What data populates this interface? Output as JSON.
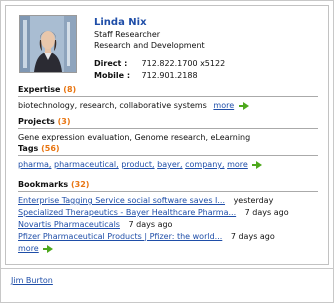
{
  "person": {
    "name": "Linda Nix",
    "title": "Staff Researcher",
    "department": "Research and Development",
    "direct_label": "Direct :",
    "direct": "712.822.1700 x5122",
    "mobile_label": "Mobile :",
    "mobile": "712.901.2188"
  },
  "expertise": {
    "label": "Expertise",
    "count": "(8)",
    "text": "biotechnology,  research,  collaborative systems",
    "more": "more"
  },
  "projects": {
    "label": "Projects",
    "count": "(3)",
    "text": "Gene expression evaluation,  Genome research,  eLearning"
  },
  "tags": {
    "label": "Tags",
    "count": "(56)",
    "items": [
      "pharma,",
      "pharmaceutical,",
      "product,",
      "bayer,",
      "company,"
    ],
    "more": "more"
  },
  "bookmarks": {
    "label": "Bookmarks",
    "count": "(32)",
    "items": [
      {
        "title": "Enterprise Tagging Service social software saves I...",
        "when": "yesterday"
      },
      {
        "title": "Specialized Therapeutics - Bayer Healthcare Pharma...",
        "when": "7 days ago"
      },
      {
        "title": "Novartis Pharmaceuticals",
        "when": "7 days ago"
      },
      {
        "title": "Pfizer Pharmaceutical Products | Pfizer: the world...",
        "when": "7 days ago"
      }
    ],
    "more": "more"
  },
  "footer": {
    "link": "Jim Burton"
  },
  "colors": {
    "link": "#1f4ea8",
    "count": "#e87511",
    "arrow": "#4da81c"
  }
}
